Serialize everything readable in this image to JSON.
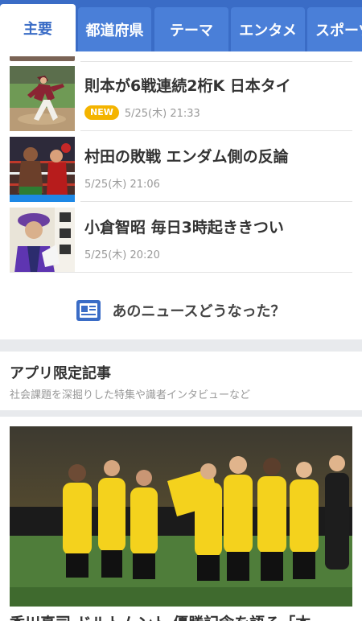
{
  "tabs": [
    {
      "label": "主要",
      "active": true
    },
    {
      "label": "都道府県",
      "active": false
    },
    {
      "label": "テーマ",
      "active": false
    },
    {
      "label": "エンタメ",
      "active": false
    },
    {
      "label": "スポーツ",
      "active": false
    }
  ],
  "news": [
    {
      "title": "則本が6戦連続2桁K 日本タイ",
      "badge": "NEW",
      "time": "5/25(木) 21:33",
      "thumb_icon": "baseball-pitcher-photo"
    },
    {
      "title": "村田の敗戦 エンダム側の反論",
      "badge": "",
      "time": "5/25(木) 21:06",
      "thumb_icon": "boxing-ring-photo"
    },
    {
      "title": "小倉智昭 毎日3時起ききつい",
      "badge": "",
      "time": "5/25(木) 20:20",
      "thumb_icon": "tv-host-photo"
    }
  ],
  "followup": {
    "label": "あのニュースどうなった？",
    "icon": "news-doc-icon",
    "icon_color": "#3a6cc6"
  },
  "app_only": {
    "heading": "アプリ限定記事",
    "subtitle": "社会課題を深掘りした特集や識者インタビューなど"
  },
  "feature": {
    "title": "香川真司 ドルトムント 優勝記念を語る「本",
    "photo_icon": "soccer-team-photo"
  },
  "colors": {
    "accent": "#3a6cc6",
    "tab_bg": "#4a7fd8",
    "badge": "#f4b400",
    "muted": "#999999"
  }
}
